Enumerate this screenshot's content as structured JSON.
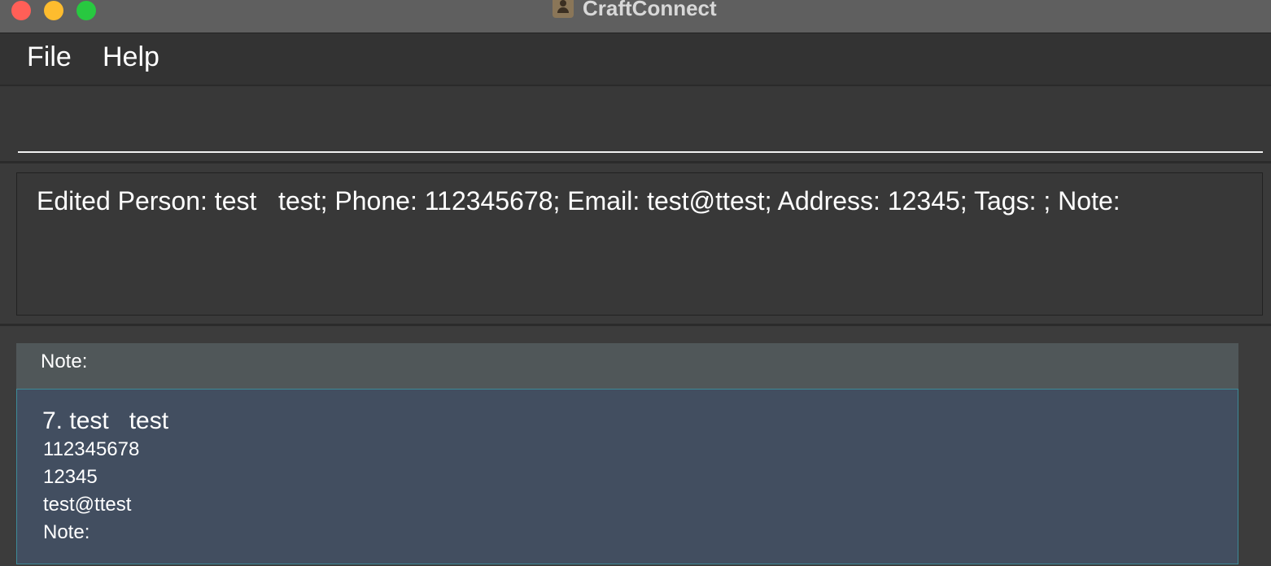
{
  "window": {
    "title": "CraftConnect"
  },
  "menu": {
    "items": [
      "File",
      "Help"
    ]
  },
  "command": {
    "value": ""
  },
  "result": {
    "text": "Edited Person: test   test; Phone: 112345678; Email: test@ttest; Address: 12345; Tags: ; Note:"
  },
  "list": {
    "header_note": "Note:",
    "persons": [
      {
        "title": "7. test   test",
        "phone": "112345678",
        "address": "12345",
        "email": "test@ttest",
        "note": "Note:"
      }
    ]
  },
  "colors": {
    "card_background": "#424e60",
    "card_border": "#3d8a98",
    "header_background": "#505759"
  }
}
